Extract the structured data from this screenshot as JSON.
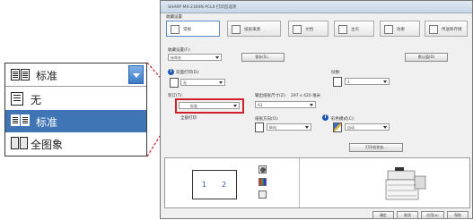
{
  "callout": {
    "selected_value": "标准",
    "options": [
      {
        "label": "无",
        "icon": "single-page-icon"
      },
      {
        "label": "标准",
        "icon": "two-page-icon",
        "highlighted": true
      },
      {
        "label": "全图象",
        "icon": "full-image-icon"
      }
    ]
  },
  "window": {
    "title": "SHARP MX-2300N PCL6 打印首选项",
    "tabs_label": "收藏设置",
    "tabs": [
      "常规",
      "纸张来源",
      "文档",
      "主页",
      "效果",
      "传送和存储",
      "作业"
    ],
    "favorites_label": "收藏设置(F):",
    "favorites_value": "未命名",
    "save_button": "保存(S)...",
    "defaults_button": "默认值(D)",
    "copies_label": "份数:",
    "copies_value": "1",
    "duplex_label": "双面打印(D):",
    "duplex_value": "无",
    "nup_label": "多页一印(N):",
    "nup_value": "1",
    "staple_label": "装订(T):",
    "staple_value": "标准",
    "paper_size_label": "输出纸张尺寸(Z):",
    "paper_size_dims": "297 x 420 毫米",
    "paper_size_value": "A3",
    "color_mode_label": "彩色模式(C):",
    "color_mode_value": "自动",
    "orientation_label": "纸张方向(O):",
    "orientation_value": "纵向",
    "print_all_label": "全部打印",
    "set_button": "打印机状态...",
    "preview_pages": [
      "1",
      "2"
    ],
    "bottom_buttons": [
      "确定",
      "取消",
      "应用(A)",
      "帮助"
    ]
  },
  "colors": {
    "highlight_blue": "#3f74b5",
    "callout_red": "#d0202a",
    "info_blue": "#1a56b0"
  }
}
